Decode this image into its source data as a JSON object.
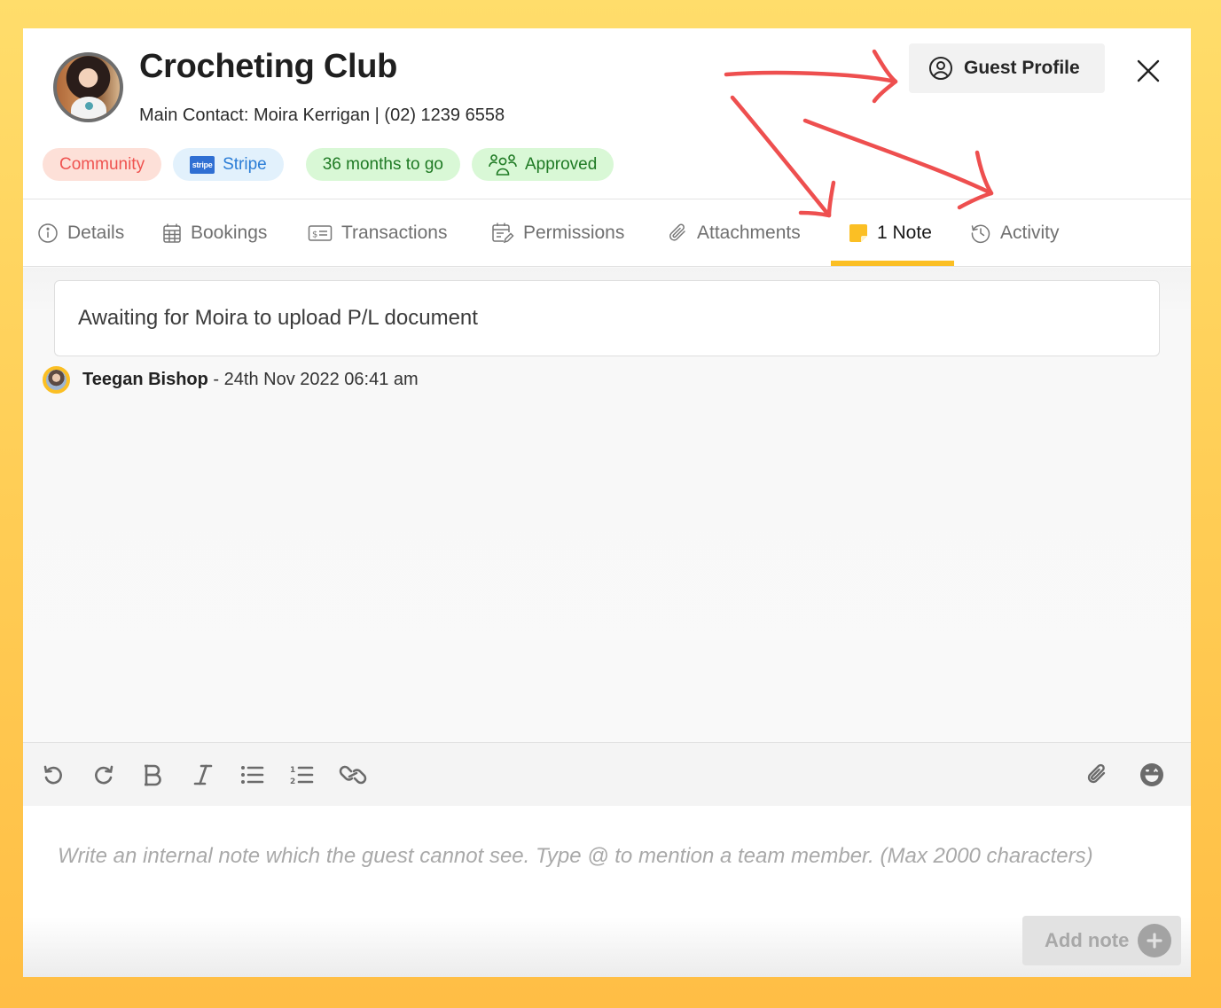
{
  "header": {
    "title": "Crocheting Club",
    "contact_line": "Main Contact: Moira Kerrigan | (02) 1239 6558",
    "badges": [
      {
        "label": "Community",
        "color": "#EF5350"
      },
      {
        "label": "Stripe",
        "color": "#2B7DD6",
        "icon": "stripe-logo"
      },
      {
        "label": "36 months to go",
        "color": "#1F7A24"
      },
      {
        "label": "Approved",
        "color": "#1F7A24",
        "icon": "users-icon"
      }
    ],
    "stripe_logo_text": "stripe",
    "guest_profile_label": "Guest Profile"
  },
  "tabs": [
    {
      "label": "Details",
      "icon": "info-icon"
    },
    {
      "label": "Bookings",
      "icon": "calendar-grid-icon"
    },
    {
      "label": "Transactions",
      "icon": "receipt-icon"
    },
    {
      "label": "Permissions",
      "icon": "calendar-edit-icon"
    },
    {
      "label": "Attachments",
      "icon": "paperclip-icon"
    },
    {
      "label": "1 Note",
      "icon": "sticky-note-icon",
      "active": true
    },
    {
      "label": "Activity",
      "icon": "history-icon"
    }
  ],
  "notes": [
    {
      "text": "Awaiting for Moira to upload P/L document",
      "author": "Teegan Bishop",
      "separator": " - ",
      "timestamp": "24th Nov 2022 06:41 am"
    }
  ],
  "toolbar": {
    "buttons": [
      "undo",
      "redo",
      "bold",
      "italic",
      "bullet-list",
      "numbered-list",
      "link"
    ],
    "right_buttons": [
      "attach",
      "emoji"
    ]
  },
  "editor": {
    "placeholder": "Write an internal note which the guest cannot see. Type @ to mention a team member. (Max 2000 characters)",
    "add_note_label": "Add note"
  },
  "colors": {
    "accent": "#FBBF24",
    "annotation": "#EF5350",
    "background_top": "#FFDD6B",
    "background_bottom": "#FFBE45"
  }
}
